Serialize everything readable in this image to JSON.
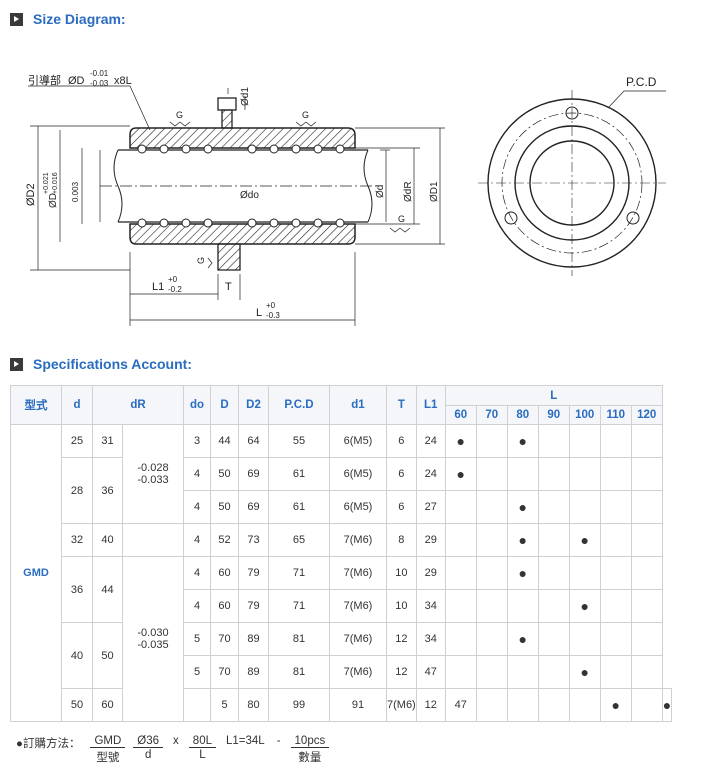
{
  "sections": {
    "size_diagram": "Size Diagram:",
    "specifications": "Specifications Account:"
  },
  "diagram": {
    "lead_label": "引導部",
    "lead_dim": "ØD",
    "lead_tol_upper": "-0.01",
    "lead_tol_lower": "-0.03",
    "lead_suffix": "x8L",
    "d1": "Ød1",
    "g": "G",
    "d2": "ØD2",
    "d_tol_label": "ØD",
    "d_tol_upper": "+0.021",
    "d_tol_lower": "+0.016",
    "runout": "0.003",
    "do": "Ødo",
    "d": "Ød",
    "dr": "ØdR",
    "d1_outer": "ØD1",
    "l1": "L1",
    "l1_upper": "+0",
    "l1_lower": "-0.2",
    "t": "T",
    "l": "L",
    "l_upper": "+0",
    "l_lower": "-0.3",
    "pcd": "P.C.D"
  },
  "table": {
    "headers": {
      "type": "型式",
      "d": "d",
      "dr": "dR",
      "do": "do",
      "D": "D",
      "D2": "D2",
      "pcd": "P.C.D",
      "d1": "d1",
      "T": "T",
      "L1": "L1",
      "L": "L"
    },
    "l_columns": [
      "60",
      "70",
      "80",
      "90",
      "100",
      "110",
      "120"
    ],
    "series": "GMD",
    "groups": [
      {
        "d": "25",
        "dr": "31"
      },
      {
        "d": "28",
        "dr": "36"
      },
      {
        "d": "32",
        "dr": "40"
      },
      {
        "d": "36",
        "dr": "44"
      },
      {
        "d": "40",
        "dr": "50"
      },
      {
        "d": "50",
        "dr": "60"
      }
    ],
    "tolerances": [
      {
        "upper": "-0.028",
        "lower": "-0.033"
      },
      {
        "upper": "-0.030",
        "lower": "-0.035"
      }
    ],
    "rows": [
      {
        "do": "3",
        "D": "44",
        "D2": "64",
        "pcd": "55",
        "d1": "6(M5)",
        "T": "6",
        "L1": "24",
        "L": [
          true,
          false,
          true,
          false,
          false,
          false,
          false
        ]
      },
      {
        "do": "4",
        "D": "50",
        "D2": "69",
        "pcd": "61",
        "d1": "6(M5)",
        "T": "6",
        "L1": "24",
        "L": [
          true,
          false,
          false,
          false,
          false,
          false,
          false
        ]
      },
      {
        "do": "4",
        "D": "50",
        "D2": "69",
        "pcd": "61",
        "d1": "6(M5)",
        "T": "6",
        "L1": "27",
        "L": [
          false,
          false,
          true,
          false,
          false,
          false,
          false
        ]
      },
      {
        "do": "4",
        "D": "52",
        "D2": "73",
        "pcd": "65",
        "d1": "7(M6)",
        "T": "8",
        "L1": "29",
        "L": [
          false,
          false,
          true,
          false,
          true,
          false,
          false
        ]
      },
      {
        "do": "4",
        "D": "60",
        "D2": "79",
        "pcd": "71",
        "d1": "7(M6)",
        "T": "10",
        "L1": "29",
        "L": [
          false,
          false,
          true,
          false,
          false,
          false,
          false
        ]
      },
      {
        "do": "4",
        "D": "60",
        "D2": "79",
        "pcd": "71",
        "d1": "7(M6)",
        "T": "10",
        "L1": "34",
        "L": [
          false,
          false,
          false,
          false,
          true,
          false,
          false
        ]
      },
      {
        "do": "5",
        "D": "70",
        "D2": "89",
        "pcd": "81",
        "d1": "7(M6)",
        "T": "12",
        "L1": "34",
        "L": [
          false,
          false,
          true,
          false,
          false,
          false,
          false
        ]
      },
      {
        "do": "5",
        "D": "70",
        "D2": "89",
        "pcd": "81",
        "d1": "7(M6)",
        "T": "12",
        "L1": "47",
        "L": [
          false,
          false,
          false,
          false,
          true,
          false,
          false
        ]
      },
      {
        "do": "5",
        "D": "80",
        "D2": "99",
        "pcd": "91",
        "d1": "7(M6)",
        "T": "12",
        "L1": "47",
        "L": [
          false,
          false,
          false,
          false,
          true,
          false,
          true
        ]
      }
    ],
    "dot": "●"
  },
  "order": {
    "label": "●訂購方法：",
    "model": "GMD",
    "model_cap": "型號",
    "dia": "Ø36",
    "dia_cap": "d",
    "x": "x",
    "len": "80L",
    "len_cap": "L",
    "l1": "L1=34L",
    "dash": "-",
    "qty": "10pcs",
    "qty_cap": "數量"
  }
}
